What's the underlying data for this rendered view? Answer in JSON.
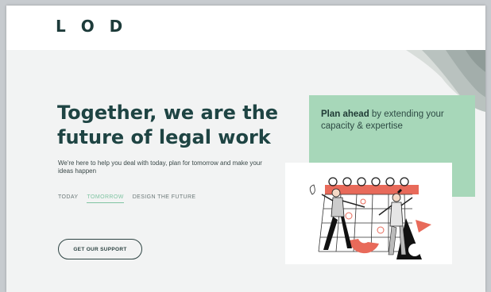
{
  "header": {
    "logo": "L O D"
  },
  "hero": {
    "headline": "Together, we are the future of legal work",
    "subtext": "We're here to help you deal with today, plan for tomorrow and make your ideas happen"
  },
  "tabs": [
    {
      "label": "TODAY",
      "active": false
    },
    {
      "label": "TOMORROW",
      "active": true
    },
    {
      "label": "DESIGN THE FUTURE",
      "active": false
    }
  ],
  "cta": {
    "label": "GET OUR SUPPORT"
  },
  "plan_card": {
    "bold": "Plan ahead",
    "rest": " by extending your capacity & expertise"
  },
  "colors": {
    "brand_dark": "#1e4443",
    "accent_green": "#a7d7b9",
    "tab_active": "#7fc4a2",
    "illustration_red": "#e86a5a"
  },
  "icons": {
    "illustration": "calendar-planning-illustration",
    "fabric": "fabric-decoration"
  }
}
